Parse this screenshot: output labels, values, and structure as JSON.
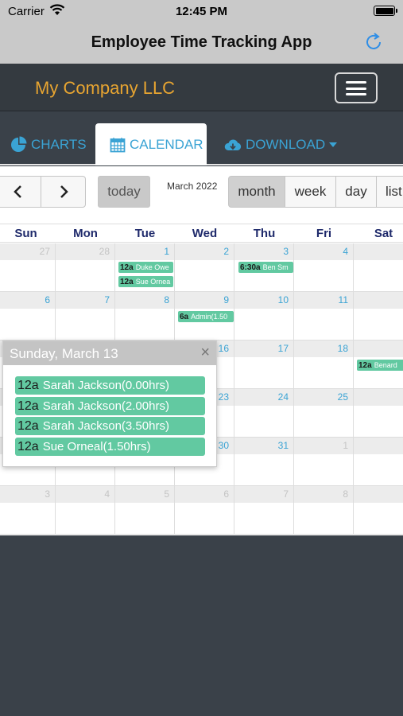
{
  "status": {
    "carrier": "Carrier",
    "time": "12:45 PM"
  },
  "app": {
    "title": "Employee Time Tracking App"
  },
  "navbar": {
    "brand": "My Company LLC"
  },
  "tabs": [
    {
      "label": "CHARTS",
      "icon": "pie-chart-icon"
    },
    {
      "label": "CALENDAR",
      "icon": "calendar-icon"
    },
    {
      "label": "DOWNLOAD",
      "icon": "cloud-download-icon"
    }
  ],
  "toolbar": {
    "prev": "‹",
    "next": "›",
    "today": "today",
    "month_label": "March 2022",
    "views": [
      "month",
      "week",
      "day",
      "list"
    ]
  },
  "weekdays": [
    "Sun",
    "Mon",
    "Tue",
    "Wed",
    "Thu",
    "Fri",
    "Sat"
  ],
  "weeks": [
    [
      "27",
      "28",
      "1",
      "2",
      "3",
      "4",
      ""
    ],
    [
      "6",
      "7",
      "8",
      "9",
      "10",
      "11",
      ""
    ],
    [
      "",
      "",
      "",
      "16",
      "17",
      "18",
      ""
    ],
    [
      "",
      "",
      "",
      "23",
      "24",
      "25",
      ""
    ],
    [
      "",
      "",
      "",
      "30",
      "31",
      "1",
      ""
    ],
    [
      "3",
      "4",
      "5",
      "6",
      "7",
      "8",
      ""
    ]
  ],
  "events": [
    {
      "time": "12a",
      "title": "Duke Owe"
    },
    {
      "time": "12a",
      "title": "Sue Ornea"
    },
    {
      "time": "6:30a",
      "title": "Ben Sm"
    },
    {
      "time": "6a",
      "title": "Admin(1.50"
    },
    {
      "time": "12a",
      "title": "Benard"
    }
  ],
  "popup": {
    "title": "Sunday, March 13",
    "close": "×",
    "events": [
      {
        "time": "12a",
        "title": "Sarah Jackson(0.00hrs)"
      },
      {
        "time": "12a",
        "title": "Sarah Jackson(2.00hrs)"
      },
      {
        "time": "12a",
        "title": "Sarah Jackson(3.50hrs)"
      },
      {
        "time": "12a",
        "title": "Sue Orneal(1.50hrs)"
      }
    ]
  },
  "colors": {
    "accent": "#3aa3d4",
    "brand": "#e8a531",
    "event": "#62c9a1",
    "navbar": "#343a40"
  }
}
